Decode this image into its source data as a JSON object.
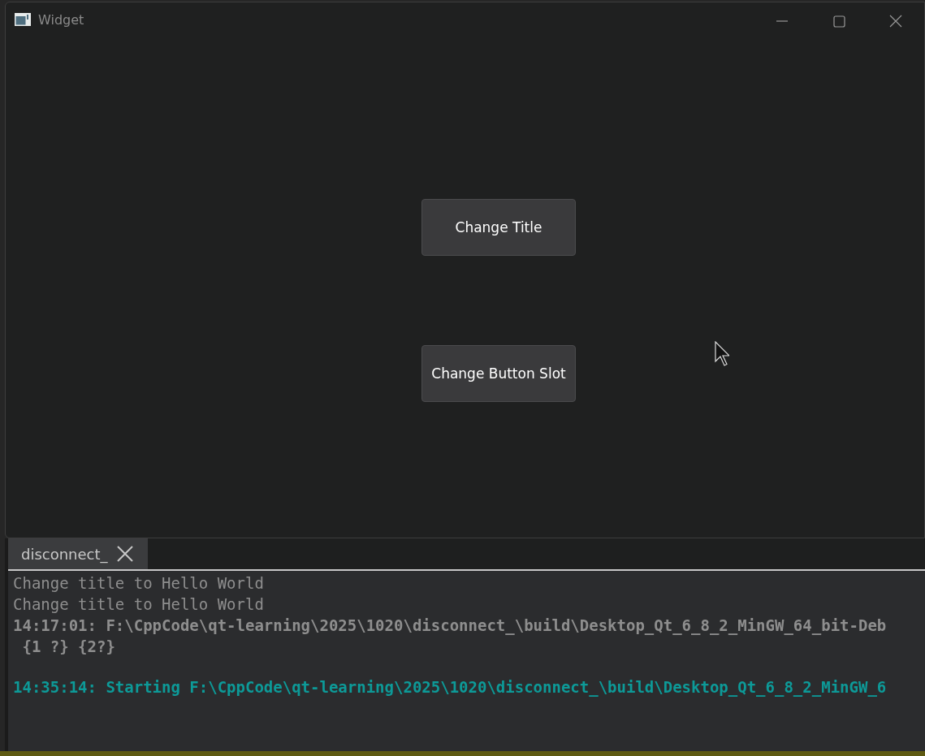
{
  "window": {
    "title": "Widget"
  },
  "buttons": [
    "Change Title",
    "Change Button Slot"
  ],
  "output_pane": {
    "tabs": [
      {
        "label": "disconnect_"
      }
    ],
    "lines": [
      {
        "kind": "stdout",
        "text": "Change title to Hello World"
      },
      {
        "kind": "stdout",
        "text": "Change title to Hello World"
      },
      {
        "kind": "info",
        "text": "14:17:01: F:\\CppCode\\qt-learning\\2025\\1020\\disconnect_\\build\\Desktop_Qt_6_8_2_MinGW_64_bit-Deb"
      },
      {
        "kind": "info",
        "text": " {1 ?} {2?}"
      },
      {
        "kind": "start",
        "text": "14:35:14: Starting F:\\CppCode\\qt-learning\\2025\\1020\\disconnect_\\build\\Desktop_Qt_6_8_2_MinGW_6"
      }
    ]
  }
}
